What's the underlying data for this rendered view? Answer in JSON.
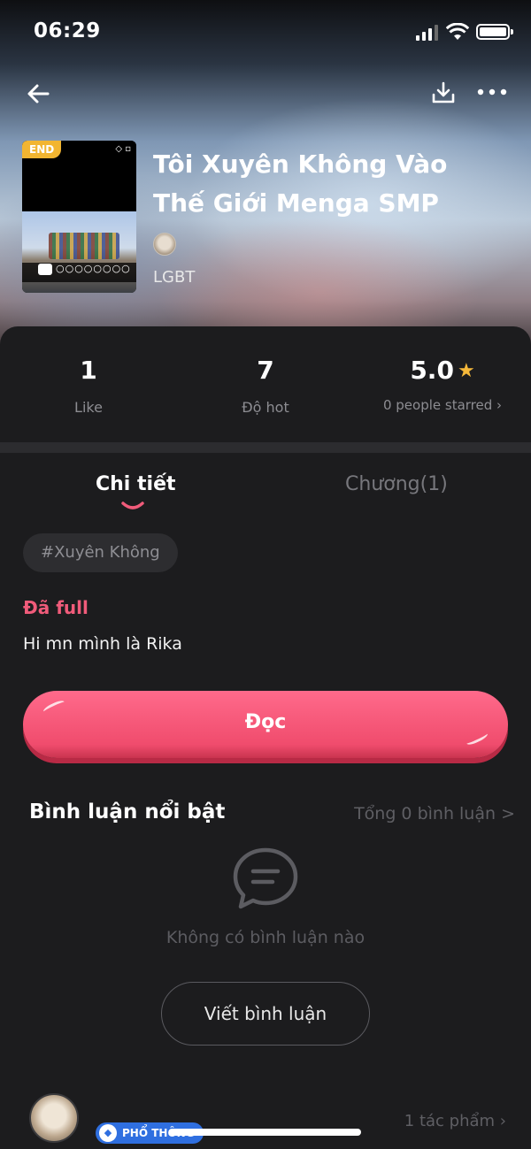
{
  "status_bar": {
    "time": "06:29"
  },
  "book": {
    "end_badge": "END",
    "title": "Tôi Xuyên Không Vào Thế Giới Menga SMP",
    "genre": "LGBT"
  },
  "stats": {
    "likes": {
      "value": "1",
      "label": "Like"
    },
    "hot": {
      "value": "7",
      "label": "Độ hot"
    },
    "rating": {
      "value": "5.0",
      "label": "0 people starred ›"
    }
  },
  "tabs": {
    "detail": "Chi tiết",
    "chapters": "Chương(1)"
  },
  "detail": {
    "tag": "#Xuyên Không",
    "status": "Đã full",
    "description": "Hi mn mình là Rika"
  },
  "read_button": "Đọc",
  "comments": {
    "title": "Bình luận nổi bật",
    "total": "Tổng 0 bình luận >",
    "empty": "Không có bình luận nào",
    "write_button": "Viết bình luận"
  },
  "author": {
    "rank_badge": "PHỔ THÔNG",
    "works": "1 tác phẩm ›"
  },
  "colors": {
    "accent": "#f05b7a",
    "star": "#f5b83a",
    "background": "#1c1c1e",
    "rank": "#2f6fe0"
  },
  "icons": [
    "back-arrow-icon",
    "download-icon",
    "more-icon",
    "star-icon",
    "comment-bubble-icon"
  ]
}
